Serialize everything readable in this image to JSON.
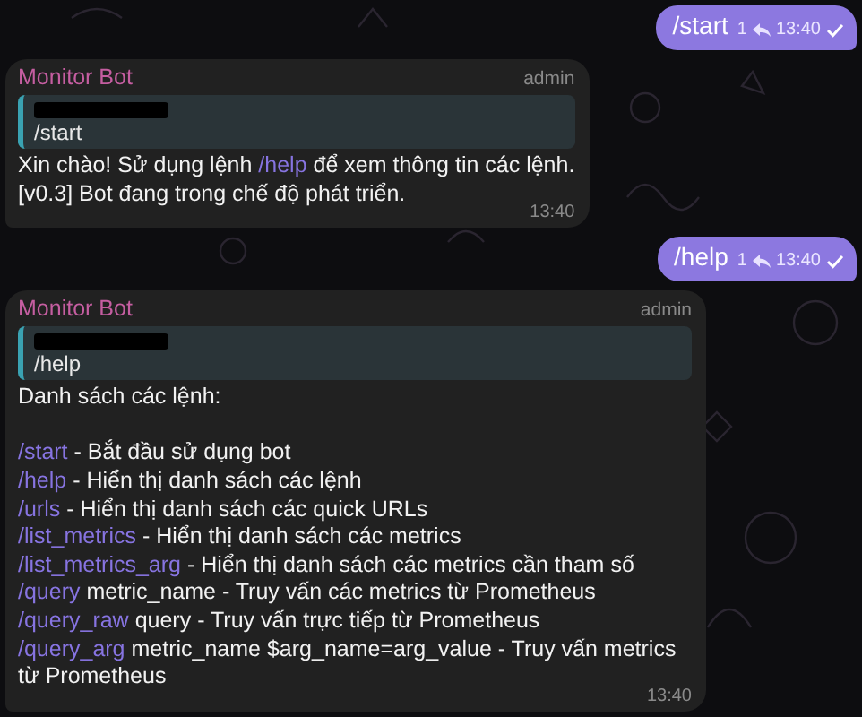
{
  "messages": [
    {
      "kind": "outgoing",
      "text": "/start",
      "replies": "1",
      "time": "13:40",
      "read": true
    },
    {
      "kind": "incoming",
      "sender": "Monitor Bot",
      "role": "admin",
      "reply_to": {
        "text": "/start"
      },
      "lines": [
        {
          "kind": "text",
          "text": "Xin chào! Sử dụng lệnh",
          "link": "/help",
          "after": "để xem thông tin các lệnh."
        },
        {
          "kind": "text",
          "text": "[v0.3] Bot đang trong chế độ phát triển."
        }
      ],
      "time": "13:40"
    },
    {
      "kind": "outgoing",
      "text": "/help",
      "replies": "1",
      "time": "13:40",
      "read": true
    },
    {
      "kind": "incoming",
      "sender": "Monitor Bot",
      "role": "admin",
      "reply_to": {
        "text": "/help"
      },
      "lines": [
        {
          "kind": "text",
          "text": "Danh sách các lệnh:"
        },
        {
          "kind": "blank"
        },
        {
          "kind": "text",
          "command": "/start",
          "text": "- Bắt đầu sử dụng bot"
        },
        {
          "kind": "text",
          "command": "/help",
          "text": "- Hiển thị danh sách các lệnh"
        },
        {
          "kind": "text",
          "command": "/urls",
          "text": "- Hiển thị danh sách các quick URLs"
        },
        {
          "kind": "text",
          "command": "/list_metrics",
          "text": "- Hiển thị danh sách các metrics"
        },
        {
          "kind": "text",
          "command": "/list_metrics_arg",
          "text": "- Hiển thị danh sách các metrics cần tham số"
        },
        {
          "kind": "text",
          "command": "/query",
          "text": "metric_name - Truy vấn các metrics từ Prometheus"
        },
        {
          "kind": "text",
          "command": "/query_raw",
          "text": "query - Truy vấn trực tiếp từ Prometheus"
        },
        {
          "kind": "text",
          "command": "/query_arg",
          "text": "metric_name $arg_name=arg_value - Truy vấn metrics từ Prometheus"
        }
      ],
      "time": "13:40"
    }
  ]
}
